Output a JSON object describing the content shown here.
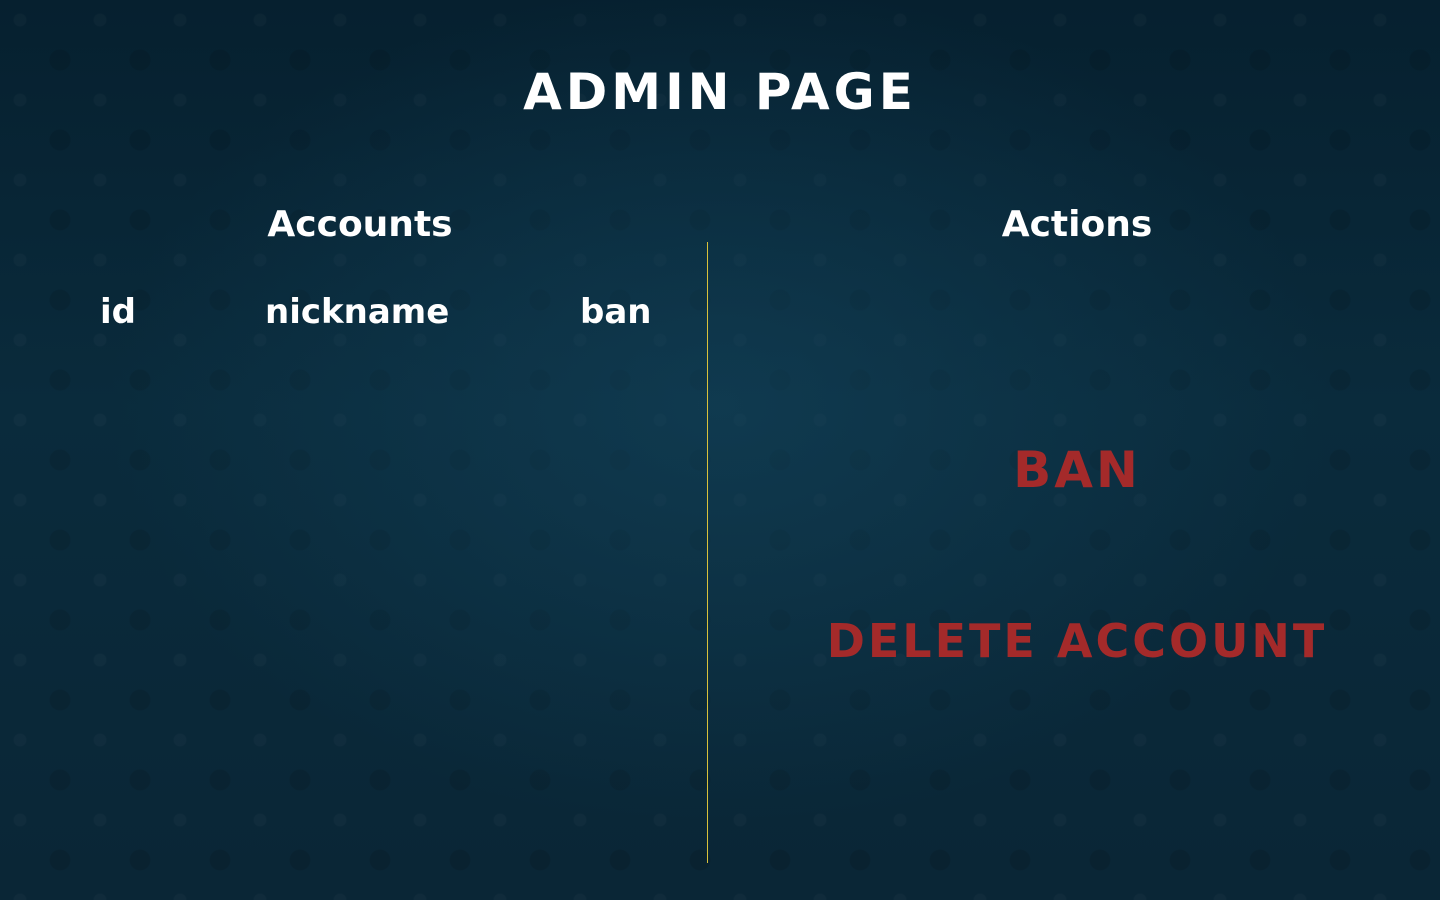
{
  "page": {
    "title": "ADMIN PAGE"
  },
  "accounts": {
    "heading": "Accounts",
    "columns": {
      "id": "id",
      "nickname": "nickname",
      "ban": "ban"
    },
    "rows": []
  },
  "actions": {
    "heading": "Actions",
    "ban_label": "BAN",
    "delete_label": "DELETE ACCOUNT"
  },
  "colors": {
    "background": "#0b2a3b",
    "text": "#ffffff",
    "action_text": "#a42a2a",
    "divider": "#d8c13a"
  }
}
